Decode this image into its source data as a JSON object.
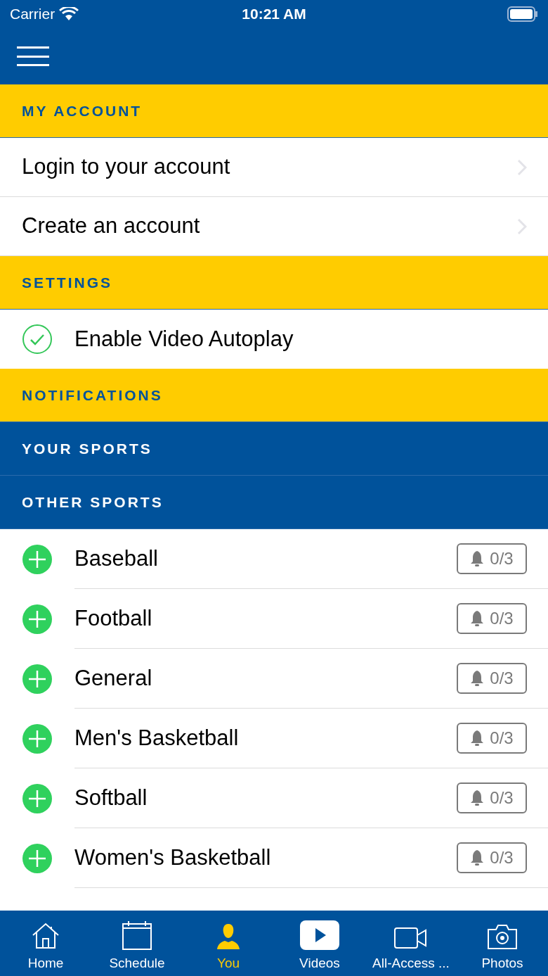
{
  "status_bar": {
    "carrier": "Carrier",
    "time": "10:21 AM"
  },
  "list": [
    {
      "kind": "header",
      "label": "MY ACCOUNT",
      "color": "#ffcc00"
    },
    {
      "kind": "link",
      "label": "Login to your account"
    },
    {
      "kind": "link",
      "label": "Create an account"
    },
    {
      "kind": "header",
      "label": "SETTINGS",
      "color": "#ffcc00"
    },
    {
      "kind": "toggle",
      "label": "Enable Video Autoplay",
      "checked": true
    },
    {
      "kind": "header",
      "label": "NOTIFICATIONS",
      "color": "#ffcc00"
    },
    {
      "kind": "header",
      "label": "YOUR SPORTS",
      "color": "#00529b"
    },
    {
      "kind": "header",
      "label": "OTHER SPORTS",
      "color": "#00529b"
    },
    {
      "kind": "sport",
      "label": "Baseball",
      "count": "0/3"
    },
    {
      "kind": "sport",
      "label": "Football",
      "count": "0/3"
    },
    {
      "kind": "sport",
      "label": "General",
      "count": "0/3"
    },
    {
      "kind": "sport",
      "label": "Men's Basketball",
      "count": "0/3"
    },
    {
      "kind": "sport",
      "label": "Softball",
      "count": "0/3"
    },
    {
      "kind": "sport",
      "label": "Women's Basketball",
      "count": "0/3"
    }
  ],
  "tab_bar": [
    {
      "label": "Home",
      "selected": false
    },
    {
      "label": "Schedule",
      "selected": false
    },
    {
      "label": "You",
      "selected": true
    },
    {
      "label": "Videos",
      "selected": false
    },
    {
      "label": "All-Access ...",
      "selected": false
    },
    {
      "label": "Photos",
      "selected": false
    }
  ]
}
